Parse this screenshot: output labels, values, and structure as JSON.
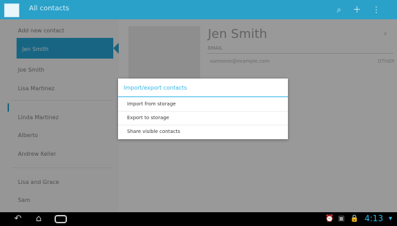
{
  "app": {
    "title": "All contacts"
  },
  "sidebar": {
    "items": [
      {
        "label": "Add new contact"
      },
      {
        "label": "Jen Smith"
      },
      {
        "label": "Joe Smith"
      },
      {
        "label": "Lisa Martinez"
      },
      {
        "label": "Linda Martinez"
      },
      {
        "label": "Alberto"
      },
      {
        "label": "Andrew Keller"
      },
      {
        "label": "Lisa and Grace"
      },
      {
        "label": "Sam"
      }
    ]
  },
  "detail": {
    "contact_name": "Jen Smith",
    "label": "EMAIL",
    "value": "someone@example.com",
    "right_value": "OTHER",
    "top_right": "x"
  },
  "dialog": {
    "title": "Import/export contacts",
    "options": [
      {
        "label": "Import from storage"
      },
      {
        "label": "Export to storage"
      },
      {
        "label": "Share visible contacts"
      }
    ]
  },
  "status": {
    "clock": "4:13"
  },
  "colors": {
    "accent": "#33b5e5",
    "action_bar": "#2aa1c9",
    "nav_bar": "#000000"
  },
  "icons": {
    "app": "contacts-app-icon",
    "search": "search-icon",
    "add_contact": "add-contact-icon",
    "overflow": "overflow-menu-icon",
    "back": "back-icon",
    "home": "home-icon",
    "recents": "recents-icon",
    "alarm": "alarm-icon",
    "screenshot": "screenshot-icon",
    "lock": "lock-icon",
    "wifi": "wifi-icon"
  }
}
